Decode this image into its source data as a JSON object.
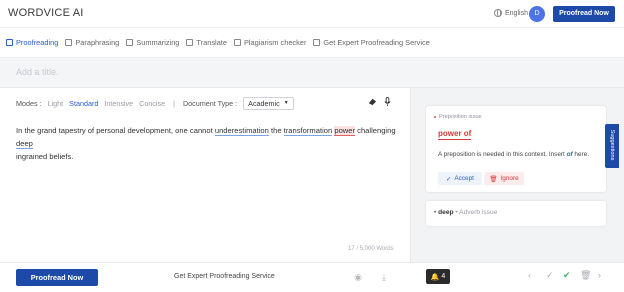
{
  "header": {
    "logo": "WORDVICE AI",
    "language": "English",
    "avatar_initial": "D",
    "cta": "Proofread Now"
  },
  "tabs": [
    {
      "label": "Proofreading",
      "icon": "proofreading-icon",
      "active": true
    },
    {
      "label": "Paraphrasing",
      "icon": "paraphrasing-icon",
      "active": false
    },
    {
      "label": "Summarizing",
      "icon": "summarizing-icon",
      "active": false
    },
    {
      "label": "Translate",
      "icon": "translate-icon",
      "active": false
    },
    {
      "label": "Plagiarism checker",
      "icon": "plagiarism-icon",
      "active": false
    },
    {
      "label": "Get Expert Proofreading Service",
      "icon": "external-link-icon",
      "active": false
    }
  ],
  "title_placeholder": "Add a title.",
  "toolbar": {
    "modes_label": "Modes :",
    "modes": [
      {
        "label": "Light",
        "active": false
      },
      {
        "label": "Standard",
        "active": true
      },
      {
        "label": "Intensive",
        "active": false
      },
      {
        "label": "Concise",
        "active": false
      }
    ],
    "separator": "|",
    "doc_type_label": "Document Type :",
    "doc_type_value": "Academic"
  },
  "editor": {
    "part1": "In the grand tapestry of personal development, one cannot ",
    "hl1": "underestimation",
    "part2": " the ",
    "hl2": "transformation",
    "part3": " ",
    "hl3": "power",
    "part4": " challenging ",
    "hl4": "deep",
    "part5": " ingrained beliefs."
  },
  "word_count": "17 / 5,000 Words",
  "suggestion_card": {
    "label": "Preposition issue",
    "phrase": "power of",
    "desc_prefix": "A preposition is needed in this context. Insert ",
    "desc_word": "of",
    "desc_suffix": " here.",
    "accept": "Accept",
    "ignore": "Ignore"
  },
  "suggestion_item": {
    "word": "deep",
    "type": "Adverb issue"
  },
  "side_tab": "Suggestions",
  "bottom": {
    "proofread": "Proofread Now",
    "expert": "Get Expert Proofreading Service",
    "issues_count": "4"
  },
  "colors": {
    "primary": "#1d4aa8",
    "accent": "#2c5ccf",
    "error": "#d33b3b"
  }
}
